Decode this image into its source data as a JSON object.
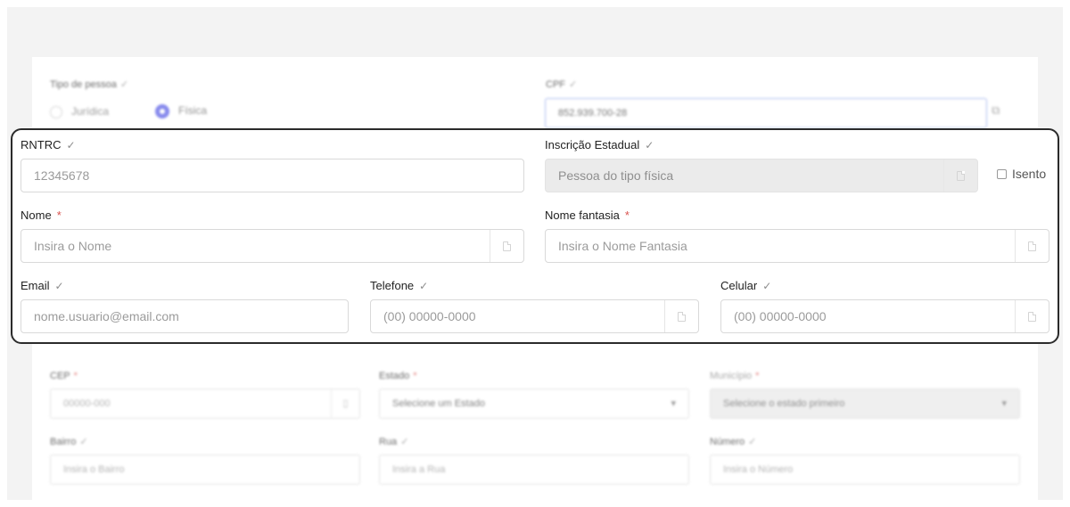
{
  "background": {
    "tipo_pessoa": {
      "label": "Tipo de pessoa",
      "check": "✓",
      "options": [
        "Jurídica",
        "Física"
      ],
      "selected": "Física"
    },
    "cpf": {
      "label": "CPF",
      "check": "✓",
      "value": "852.939.700-28"
    },
    "cep": {
      "label": "CEP",
      "required": "*",
      "placeholder": "00000-000"
    },
    "estado": {
      "label": "Estado",
      "required": "*",
      "value": "Selecione um Estado",
      "arrow": "▾"
    },
    "municipio": {
      "label": "Município",
      "required": "*",
      "value": "Selecione o estado primeiro",
      "arrow": "▾"
    },
    "bairro": {
      "label": "Bairro",
      "check": "✓",
      "placeholder": "Insira o Bairro"
    },
    "rua": {
      "label": "Rua",
      "check": "✓",
      "placeholder": "Insira a Rua"
    },
    "numero": {
      "label": "Número",
      "check": "✓",
      "placeholder": "Insira o Número"
    }
  },
  "form": {
    "rntrc": {
      "label": "RNTRC",
      "check": "✓",
      "placeholder": "12345678"
    },
    "inscricao_estadual": {
      "label": "Inscrição Estadual",
      "check": "✓",
      "value": "Pessoa do tipo física"
    },
    "isento": {
      "label": "Isento",
      "checked": false
    },
    "nome": {
      "label": "Nome",
      "required": "*",
      "placeholder": "Insira o Nome"
    },
    "nome_fantasia": {
      "label": "Nome fantasia",
      "required": "*",
      "placeholder": "Insira o Nome Fantasia"
    },
    "email": {
      "label": "Email",
      "check": "✓",
      "placeholder": "nome.usuario@email.com"
    },
    "telefone": {
      "label": "Telefone",
      "check": "✓",
      "placeholder": "(00) 00000-0000"
    },
    "celular": {
      "label": "Celular",
      "check": "✓",
      "placeholder": "(00) 00000-0000"
    }
  },
  "colors": {
    "radio_accent": "#5a5ee6",
    "required": "#d9534f",
    "highlight_border": "#2b2b2b"
  }
}
